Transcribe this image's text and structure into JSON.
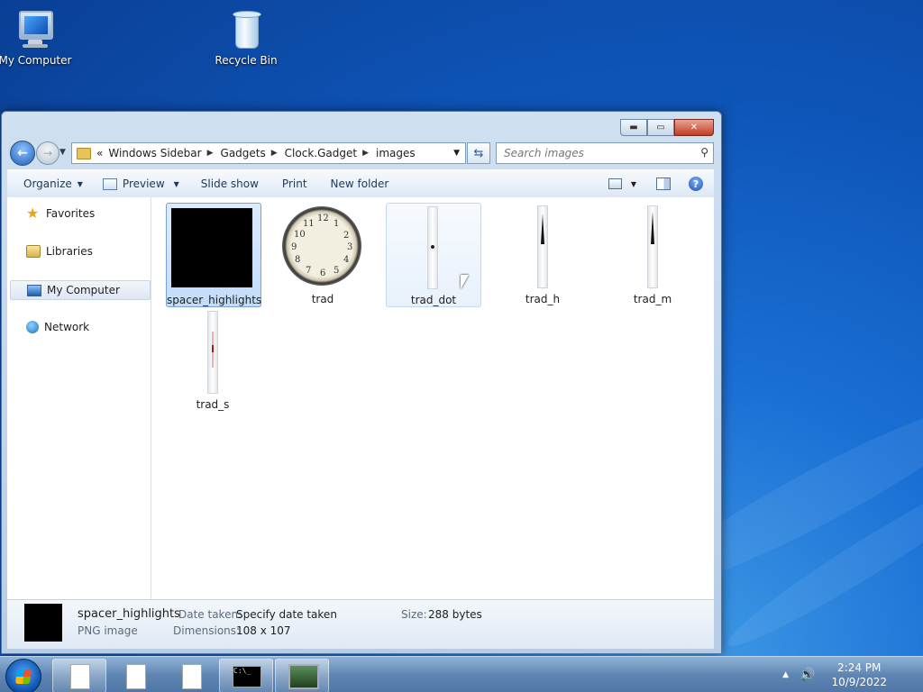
{
  "desktop": {
    "icons": [
      {
        "label": "My Computer"
      },
      {
        "label": "Recycle Bin"
      }
    ]
  },
  "window": {
    "caption_buttons": {
      "minimize": "▬",
      "maximize": "▭",
      "close": "✕"
    },
    "address": {
      "prefix": "«",
      "crumbs": [
        "Windows Sidebar",
        "Gadgets",
        "Clock.Gadget",
        "images"
      ]
    },
    "search": {
      "placeholder": "Search images"
    },
    "toolbar": {
      "organize": "Organize",
      "preview": "Preview",
      "slideshow": "Slide show",
      "print": "Print",
      "new_folder": "New folder"
    },
    "nav": {
      "items": [
        {
          "label": "Favorites",
          "icon": "star-icon"
        },
        {
          "label": "Libraries",
          "icon": "library-icon"
        },
        {
          "label": "My Computer",
          "icon": "computer-icon",
          "selected": true
        },
        {
          "label": "Network",
          "icon": "network-icon"
        }
      ]
    },
    "files": [
      {
        "name": "spacer_highlights",
        "state": "selected"
      },
      {
        "name": "trad",
        "state": "normal"
      },
      {
        "name": "trad_dot",
        "state": "hover"
      },
      {
        "name": "trad_h",
        "state": "normal"
      },
      {
        "name": "trad_m",
        "state": "normal"
      },
      {
        "name": "trad_s",
        "state": "normal"
      }
    ],
    "clock_numerals": [
      "12",
      "1",
      "2",
      "3",
      "4",
      "5",
      "6",
      "7",
      "8",
      "9",
      "10",
      "11"
    ],
    "details": {
      "name": "spacer_highlights",
      "type": "PNG image",
      "date_key": "Date taken:",
      "date_value": "Specify date taken",
      "dim_key": "Dimensions:",
      "dim_value": "108 x 107",
      "size_key": "Size:",
      "size_value": "288 bytes"
    }
  },
  "taskbar": {
    "time": "2:24 PM",
    "date": "10/9/2022",
    "cmd_text": "C:\\_"
  }
}
